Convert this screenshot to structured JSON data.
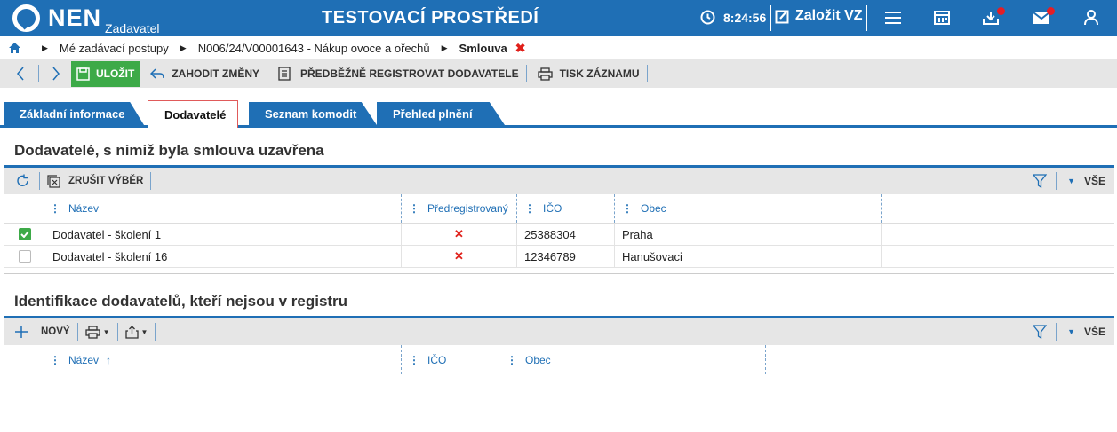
{
  "app": {
    "name": "NEN",
    "subtitle": "Zadavatel",
    "environment": "TESTOVACÍ PROSTŘEDÍ",
    "time": "8:24:56",
    "create_label": "Založit VZ"
  },
  "colors": {
    "primary": "#1f6fb5",
    "save": "#3daa48",
    "danger": "#e0201a",
    "badge": "#e41e26"
  },
  "breadcrumb": {
    "items": [
      "Mé zadávací postupy",
      "N006/24/V00001643 - Nákup ovoce a ořechů",
      "Smlouva"
    ]
  },
  "toolbar": {
    "save": "ULOŽIT",
    "discard": "ZAHODIT ZMĚNY",
    "prereg": "PŘEDBĚŽNĚ REGISTROVAT DODAVATELE",
    "print": "TISK ZÁZNAMU"
  },
  "tabs": [
    {
      "label": "Základní informace"
    },
    {
      "label": "Dodavatelé"
    },
    {
      "label": "Seznam komodit"
    },
    {
      "label": "Přehled plnění"
    }
  ],
  "section1": {
    "title": "Dodavatelé, s nimiž byla smlouva uzavřena",
    "clear_selection": "ZRUŠIT VÝBĚR",
    "all": "VŠE",
    "columns": [
      "Název",
      "Předregistrovaný",
      "IČO",
      "Obec"
    ],
    "rows": [
      {
        "name": "Dodavatel - školení 1",
        "prereg": "✕",
        "ico": "25388304",
        "obec": "Praha",
        "checked": true
      },
      {
        "name": "Dodavatel - školení 16",
        "prereg": "✕",
        "ico": "12346789",
        "obec": "Hanušovaci",
        "checked": false
      }
    ]
  },
  "section2": {
    "title": "Identifikace dodavatelů, kteří nejsou v registru",
    "new": "NOVÝ",
    "all": "VŠE",
    "columns": [
      "Název",
      "IČO",
      "Obec"
    ],
    "sort_indicator": "↑"
  }
}
